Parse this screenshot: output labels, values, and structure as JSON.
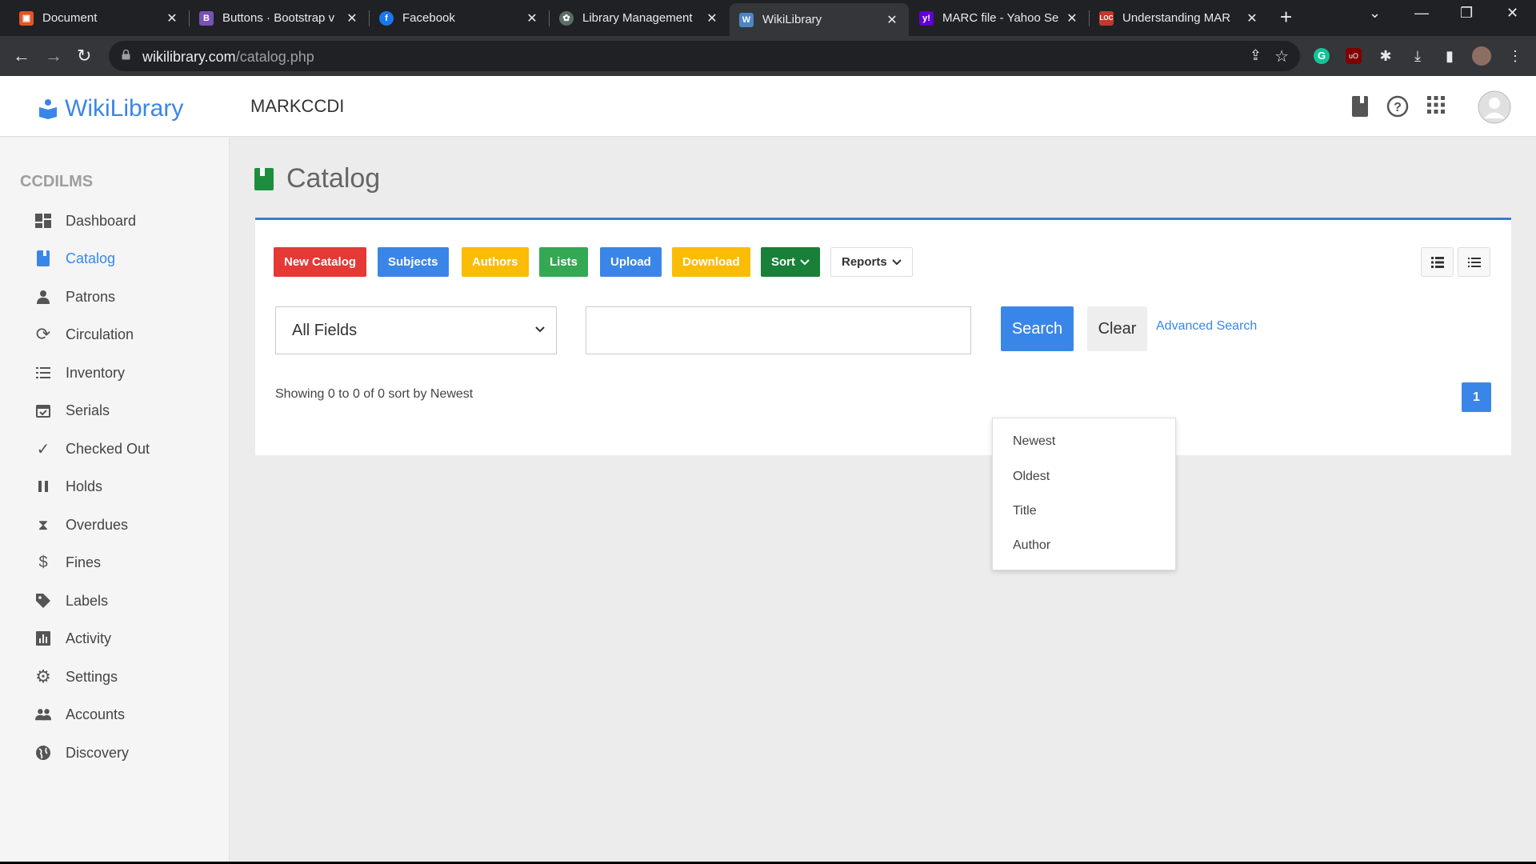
{
  "browser": {
    "tabs": [
      {
        "title": "Document",
        "icon": "document-favicon",
        "color": "#e0552a",
        "glyph": "B"
      },
      {
        "title": "Buttons · Bootstrap v",
        "icon": "bootstrap-favicon",
        "color": "#7952b3",
        "glyph": "B"
      },
      {
        "title": "Facebook",
        "icon": "facebook-favicon",
        "color": "#1877f2",
        "glyph": "f"
      },
      {
        "title": "Library Management",
        "icon": "openai-favicon",
        "color": "#5a6e66",
        "glyph": "✿"
      },
      {
        "title": "WikiLibrary",
        "icon": "wikilibrary-favicon",
        "color": "#4c86c6",
        "glyph": "W"
      },
      {
        "title": "MARC file - Yahoo Se",
        "icon": "yahoo-favicon",
        "color": "#6001d2",
        "glyph": "y!"
      },
      {
        "title": "Understanding MAR",
        "icon": "loc-favicon",
        "color": "#c0392b",
        "glyph": "LOC"
      }
    ],
    "active_tab": 4,
    "url_host": "wikilibrary.com",
    "url_path": "/catalog.php"
  },
  "app": {
    "brand": "WikiLibrary",
    "org": "MARKCCDI",
    "accent": "#3a86e8"
  },
  "sidebar": {
    "heading": "CCDILMS",
    "items": [
      {
        "label": "Dashboard",
        "icon": "dashboard-icon"
      },
      {
        "label": "Catalog",
        "icon": "book-icon",
        "active": true
      },
      {
        "label": "Patrons",
        "icon": "person-icon"
      },
      {
        "label": "Circulation",
        "icon": "refresh-icon"
      },
      {
        "label": "Inventory",
        "icon": "list-icon"
      },
      {
        "label": "Serials",
        "icon": "calendar-check-icon"
      },
      {
        "label": "Checked Out",
        "icon": "checkmark-icon"
      },
      {
        "label": "Holds",
        "icon": "pause-icon"
      },
      {
        "label": "Overdues",
        "icon": "hourglass-icon"
      },
      {
        "label": "Fines",
        "icon": "dollar-icon"
      },
      {
        "label": "Labels",
        "icon": "tag-icon"
      },
      {
        "label": "Activity",
        "icon": "bar-chart-icon"
      },
      {
        "label": "Settings",
        "icon": "gear-icon"
      },
      {
        "label": "Accounts",
        "icon": "people-icon"
      },
      {
        "label": "Discovery",
        "icon": "globe-icon"
      }
    ]
  },
  "main": {
    "title": "Catalog",
    "toolbar": {
      "new_catalog": "New Catalog",
      "subjects": "Subjects",
      "authors": "Authors",
      "lists": "Lists",
      "upload": "Upload",
      "download": "Download",
      "sort": "Sort",
      "reports": "Reports"
    },
    "colors": {
      "new_catalog": "#e53935",
      "subjects": "#3a86e8",
      "authors": "#fbbc05",
      "lists": "#34a853",
      "upload": "#3a86e8",
      "download": "#fbbc05",
      "sort": "#188038"
    },
    "search": {
      "field_select": "All Fields",
      "query": "",
      "search_label": "Search",
      "clear_label": "Clear",
      "advanced_label": "Advanced Search"
    },
    "results_text": "Showing 0 to 0 of 0 sort by Newest",
    "pagination": {
      "current": "1"
    },
    "sort_menu": [
      "Newest",
      "Oldest",
      "Title",
      "Author"
    ]
  }
}
